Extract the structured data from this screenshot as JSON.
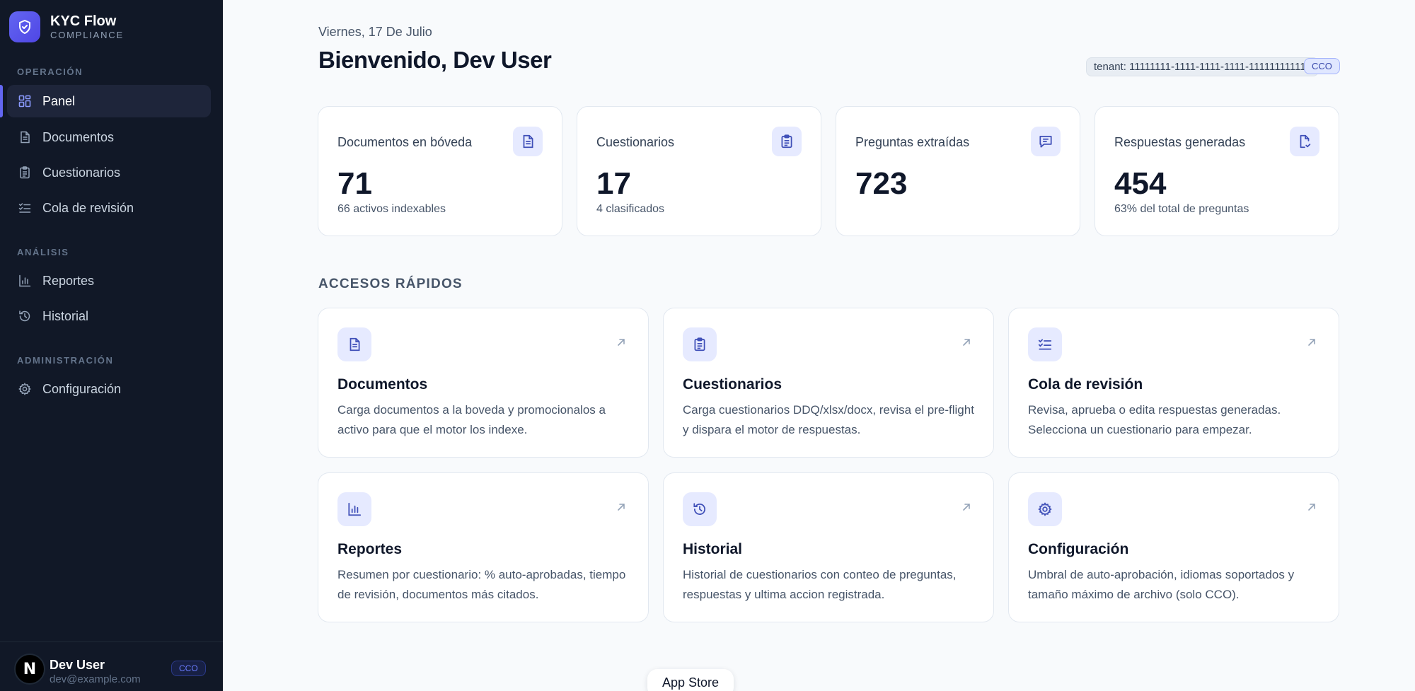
{
  "brand": {
    "name": "KYC Flow",
    "subtitle": "COMPLIANCE"
  },
  "sidebar": {
    "sections": [
      {
        "label": "OPERACIÓN"
      },
      {
        "label": "ANÁLISIS"
      },
      {
        "label": "ADMINISTRACIÓN"
      }
    ],
    "items": [
      {
        "label": "Panel",
        "icon": "grid-icon",
        "active": true
      },
      {
        "label": "Documentos",
        "icon": "document-icon"
      },
      {
        "label": "Cuestionarios",
        "icon": "clipboard-icon"
      },
      {
        "label": "Cola de revisión",
        "icon": "list-check-icon"
      },
      {
        "label": "Reportes",
        "icon": "bar-chart-icon"
      },
      {
        "label": "Historial",
        "icon": "history-icon"
      },
      {
        "label": "Configuración",
        "icon": "gear-icon"
      }
    ]
  },
  "user": {
    "avatar_letter": "N",
    "name": "Dev User",
    "email": "dev@example.com",
    "role": "CCO"
  },
  "header": {
    "date": "Viernes, 17 De Julio",
    "welcome": "Bienvenido, Dev User",
    "tenant": "tenant: 11111111-1111-1111-1111-111111111111",
    "role_badge": "CCO"
  },
  "stats": [
    {
      "label": "Documentos en bóveda",
      "value": "71",
      "sub": "66 activos indexables",
      "icon": "document-icon"
    },
    {
      "label": "Cuestionarios",
      "value": "17",
      "sub": "4 clasificados",
      "icon": "clipboard-icon"
    },
    {
      "label": "Preguntas extraídas",
      "value": "723",
      "sub": "",
      "icon": "message-icon"
    },
    {
      "label": "Respuestas generadas",
      "value": "454",
      "sub": "63% del total de preguntas",
      "icon": "file-check-icon"
    }
  ],
  "quick_access": {
    "title": "ACCESOS RÁPIDOS",
    "cards": [
      {
        "title": "Documentos",
        "desc": "Carga documentos a la boveda y promocionalos a activo para que el motor los indexe.",
        "icon": "document-icon"
      },
      {
        "title": "Cuestionarios",
        "desc": "Carga cuestionarios DDQ/xlsx/docx, revisa el pre-flight y dispara el motor de respuestas.",
        "icon": "clipboard-icon"
      },
      {
        "title": "Cola de revisión",
        "desc": "Revisa, aprueba o edita respuestas generadas. Selecciona un cuestionario para empezar.",
        "icon": "list-check-icon"
      },
      {
        "title": "Reportes",
        "desc": "Resumen por cuestionario: % auto-aprobadas, tiempo de revisión, documentos más citados.",
        "icon": "bar-chart-icon"
      },
      {
        "title": "Historial",
        "desc": "Historial de cuestionarios con conteo de preguntas, respuestas y ultima accion registrada.",
        "icon": "history-icon"
      },
      {
        "title": "Configuración",
        "desc": "Umbral de auto-aprobación, idiomas soportados y tamaño máximo de archivo (solo CCO).",
        "icon": "gear-icon"
      }
    ]
  },
  "overlay": {
    "app_store": "App Store"
  },
  "colors": {
    "sidebar_bg": "#111827",
    "accent": "#6366f1",
    "page_bg": "#f8fafc",
    "icon_bg": "#e6eaff"
  }
}
